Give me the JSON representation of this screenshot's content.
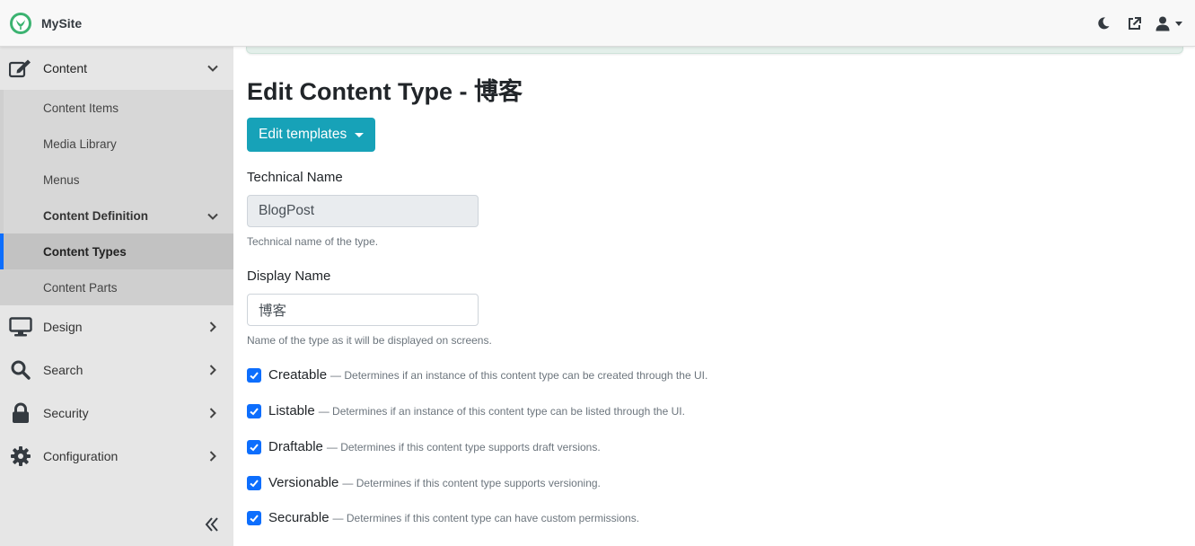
{
  "brand": {
    "name": "MySite"
  },
  "sidebar": {
    "content": {
      "label": "Content",
      "items": [
        {
          "label": "Content Items"
        },
        {
          "label": "Media Library"
        },
        {
          "label": "Menus"
        }
      ],
      "definition": {
        "label": "Content Definition",
        "items": [
          {
            "label": "Content Types",
            "active": true
          },
          {
            "label": "Content Parts"
          }
        ]
      }
    },
    "groups": [
      {
        "label": "Design",
        "icon": "monitor-icon"
      },
      {
        "label": "Search",
        "icon": "search-icon"
      },
      {
        "label": "Security",
        "icon": "lock-icon"
      },
      {
        "label": "Configuration",
        "icon": "gear-icon"
      }
    ]
  },
  "main": {
    "title": "Edit Content Type - 博客",
    "templates_button": "Edit templates",
    "technical_name": {
      "label": "Technical Name",
      "value": "BlogPost",
      "help": "Technical name of the type."
    },
    "display_name": {
      "label": "Display Name",
      "value": "博客",
      "help": "Name of the type as it will be displayed on screens."
    },
    "options": [
      {
        "label": "Creatable",
        "desc": "— Determines if an instance of this content type can be created through the UI.",
        "checked": true
      },
      {
        "label": "Listable",
        "desc": "— Determines if an instance of this content type can be listed through the UI.",
        "checked": true
      },
      {
        "label": "Draftable",
        "desc": "— Determines if this content type supports draft versions.",
        "checked": true
      },
      {
        "label": "Versionable",
        "desc": "— Determines if this content type supports versioning.",
        "checked": true
      },
      {
        "label": "Securable",
        "desc": "— Determines if this content type can have custom permissions.",
        "checked": true
      }
    ]
  },
  "colors": {
    "accent": "#17a2b8",
    "checkbox": "#0d6efd",
    "active_indicator": "#0d6efd",
    "logo": "#3cb371"
  }
}
